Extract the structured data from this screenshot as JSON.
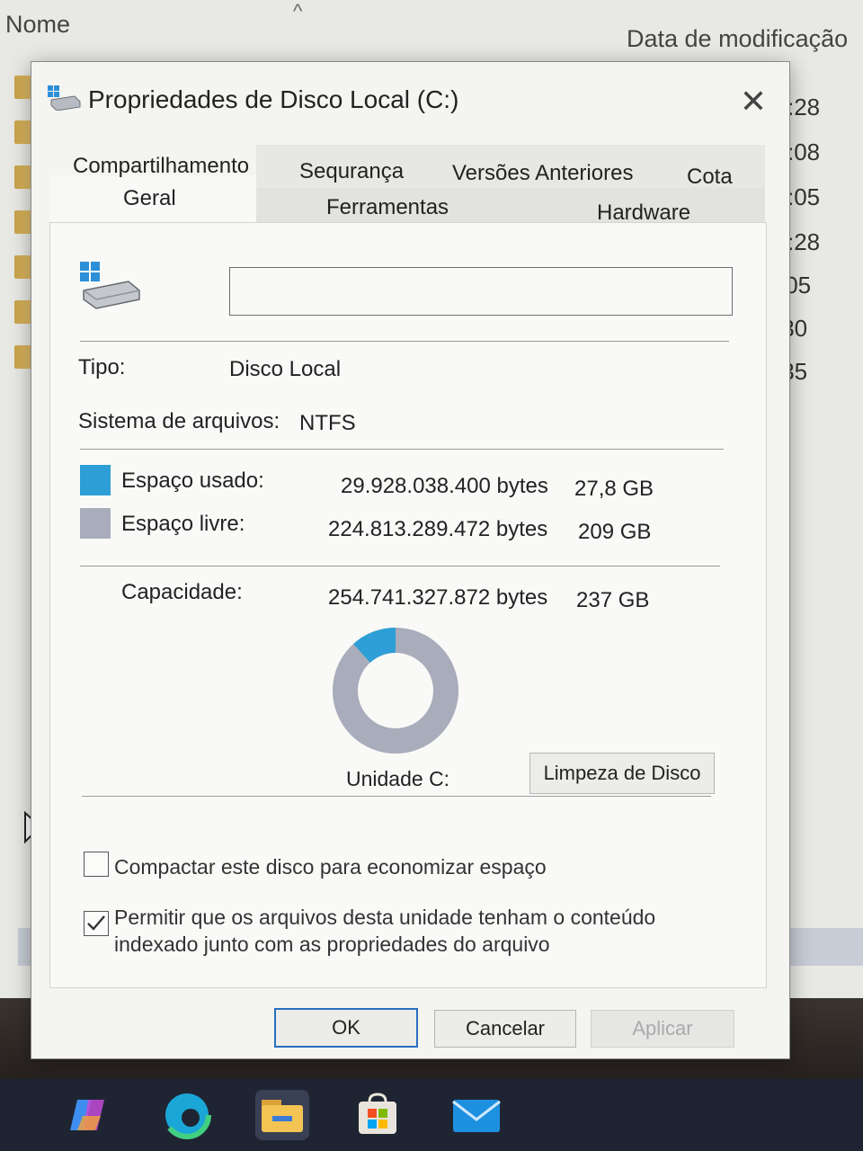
{
  "explorer": {
    "col_name": "Nome",
    "col_date": "Data de modificação",
    "sort_arrow": "^",
    "times": [
      ":28",
      ":08",
      ":05",
      ":28",
      ":05",
      ":30",
      ":35"
    ]
  },
  "dialog": {
    "title": "Propriedades de Disco Local (C:)",
    "close_glyph": "✕",
    "tabs_top": [
      "Compartilhamento",
      "Sequrança",
      "Versões Anteriores",
      "Cota"
    ],
    "tabs_bottom": [
      "Geral",
      "Ferramentas",
      "Hardware"
    ],
    "active_tab": "Geral",
    "name_value": "",
    "type_label": "Tipo:",
    "type_value": "Disco Local",
    "fs_label": "Sistema de arquivos:",
    "fs_value": "NTFS",
    "used": {
      "label": "Espaço usado:",
      "bytes": "29.928.038.400 bytes",
      "size": "27,8 GB",
      "color": "#2e9fd6"
    },
    "free": {
      "label": "Espaço livre:",
      "bytes": "224.813.289.472 bytes",
      "size": "209 GB",
      "color": "#a9acbb"
    },
    "capacity": {
      "label": "Capacidade:",
      "bytes": "254.741.327.872 bytes",
      "size": "237 GB"
    },
    "used_fraction": 0.117,
    "drive_caption": "Unidade C:",
    "cleanup_button": "Limpeza de Disco",
    "compress": {
      "label": "Compactar este disco para economizar espaço",
      "checked": false
    },
    "index": {
      "label_line1": "Permitir que os arquivos desta unidade tenham o conteúdo",
      "label_line2": "indexado junto com as propriedades do arquivo",
      "checked": true
    },
    "ok": "OK",
    "cancel": "Cancelar",
    "apply": "Aplicar"
  },
  "taskbar": {
    "apps": [
      "copilot-icon",
      "edge-icon",
      "file-explorer-icon",
      "store-icon",
      "mail-icon"
    ]
  }
}
